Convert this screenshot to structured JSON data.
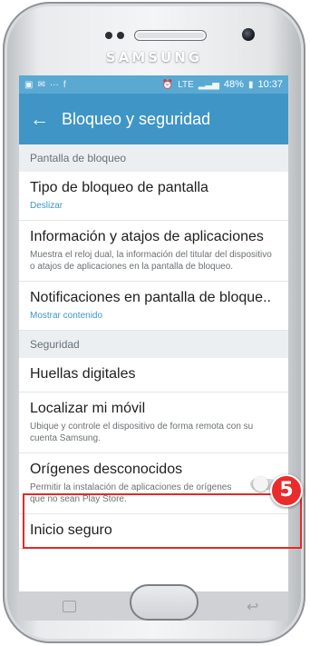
{
  "device": {
    "brand": "SAMSUNG"
  },
  "statusbar": {
    "left_icons": [
      "image-icon",
      "message-icon",
      "dots-icon",
      "facebook-icon"
    ],
    "right_text": "LTE",
    "battery": "48%",
    "time": "10:37"
  },
  "appbar": {
    "title": "Bloqueo y seguridad"
  },
  "sections": [
    {
      "header": "Pantalla de bloqueo",
      "items": [
        {
          "title": "Tipo de bloqueo de pantalla",
          "subtitle": "Deslizar"
        },
        {
          "title": "Información y atajos de aplicaciones",
          "subtitle": "Muestra el reloj dual, la información del titular del dispositivo o atajos de aplicaciones en la pantalla de bloqueo."
        },
        {
          "title": "Notificaciones en pantalla de bloque..",
          "subtitle": "Mostrar contenido"
        }
      ]
    },
    {
      "header": "Seguridad",
      "items": [
        {
          "title": "Huellas digitales"
        },
        {
          "title": "Localizar mi móvil",
          "subtitle": "Ubique y controle el dispositivo de forma remota con su cuenta Samsung."
        },
        {
          "title": "Orígenes desconocidos",
          "subtitle": "Permitir la instalación de aplicaciones de orígenes que no sean Play Store.",
          "toggle_on": false
        },
        {
          "title": "Inicio seguro"
        }
      ]
    }
  ],
  "annotation": {
    "step": "5",
    "color": "#e22a2a"
  },
  "colors": {
    "appbar": "#3f95c6",
    "statusbar": "#5aa9d3",
    "accent": "#3f95c6"
  }
}
